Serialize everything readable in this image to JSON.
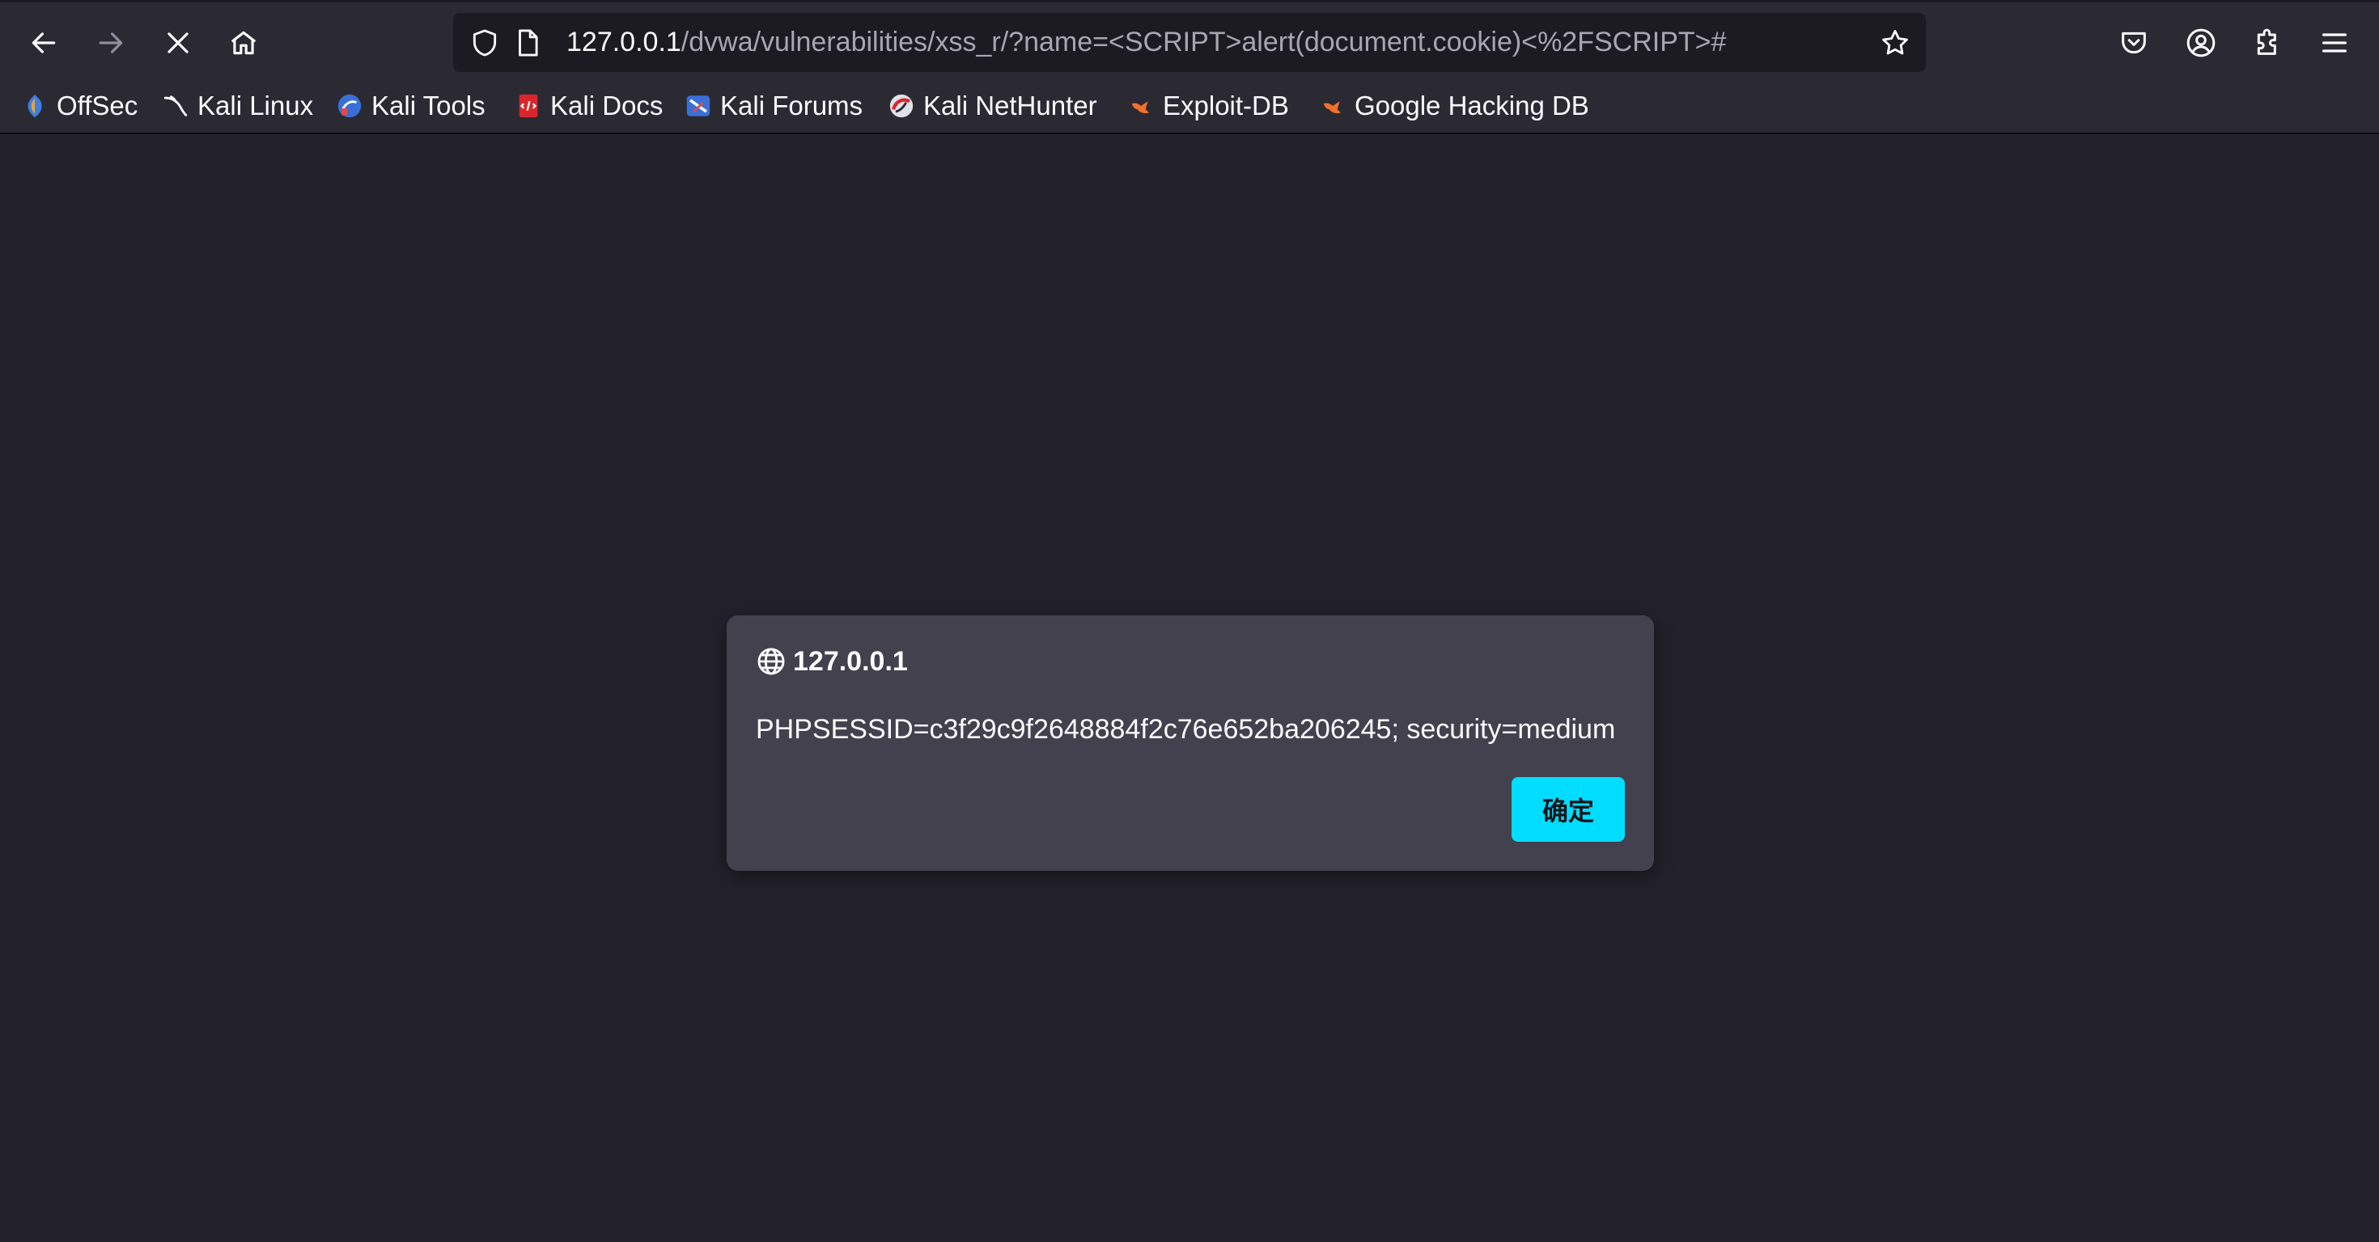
{
  "toolbar": {
    "back_icon": "arrow-left-icon",
    "forward_icon": "arrow-right-icon",
    "stop_icon": "close-icon",
    "home_icon": "home-icon"
  },
  "urlbar": {
    "host": "127.0.0.1",
    "path": "/dvwa/vulnerabilities/xss_r/?name=<SCRIPT>alert(document.cookie)<%2FSCRIPT>#",
    "shield_icon": "shield-icon",
    "page_icon": "page-icon",
    "bookmark_icon": "star-icon"
  },
  "right_icons": [
    "pocket-icon",
    "account-icon",
    "extensions-icon",
    "menu-icon"
  ],
  "bookmarks": [
    {
      "label": "OffSec",
      "icon": "offsec-icon"
    },
    {
      "label": "Kali Linux",
      "icon": "kali-dragon-icon"
    },
    {
      "label": "Kali Tools",
      "icon": "kali-tools-icon"
    },
    {
      "label": "Kali Docs",
      "icon": "kali-docs-icon"
    },
    {
      "label": "Kali Forums",
      "icon": "kali-forums-icon"
    },
    {
      "label": "Kali NetHunter",
      "icon": "nethunter-icon"
    },
    {
      "label": "Exploit-DB",
      "icon": "exploit-db-icon"
    },
    {
      "label": "Google Hacking DB",
      "icon": "ghdb-icon"
    }
  ],
  "dialog": {
    "origin": "127.0.0.1",
    "message": "PHPSESSID=c3f29c9f2648884f2c76e652ba206245; security=medium",
    "ok_label": "确定",
    "globe_icon": "globe-icon"
  },
  "colors": {
    "toolbar_bg": "#2b2a33",
    "urlbar_bg": "#1c1b22",
    "page_bg": "#23222b",
    "dialog_bg": "#42414d",
    "accent_button": "#00ddff"
  }
}
